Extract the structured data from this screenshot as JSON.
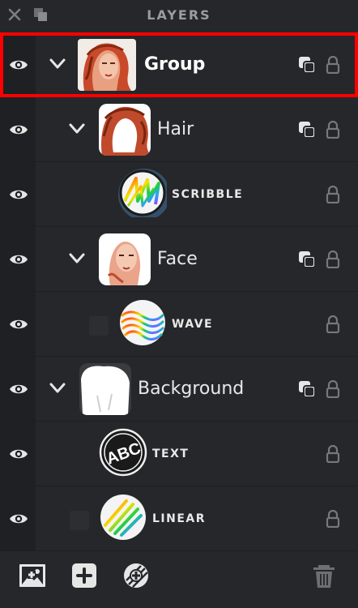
{
  "header": {
    "title": "LAYERS",
    "close_icon": "close-icon",
    "collapse_icon": "collapse-panel-icon"
  },
  "layers": [
    {
      "name": "Group",
      "style": "bold",
      "depth": 0,
      "expanded": true,
      "selected": true,
      "has_mask_button": true,
      "thumb": "portrait"
    },
    {
      "name": "Hair",
      "style": "big",
      "depth": 1,
      "expanded": true,
      "selected": false,
      "has_mask_button": true,
      "thumb": "hair"
    },
    {
      "name": "SCRIBBLE",
      "style": "small",
      "depth": 2,
      "expanded": false,
      "selected": false,
      "has_mask_button": false,
      "thumb": "scribble"
    },
    {
      "name": "Face",
      "style": "big",
      "depth": 1,
      "expanded": true,
      "selected": false,
      "has_mask_button": true,
      "thumb": "face"
    },
    {
      "name": "WAVE",
      "style": "small",
      "depth": 2,
      "expanded": false,
      "selected": false,
      "has_mask_button": false,
      "thumb": "wave"
    },
    {
      "name": "Background",
      "style": "big",
      "depth": 0,
      "expanded": true,
      "selected": false,
      "has_mask_button": true,
      "thumb": "background"
    },
    {
      "name": "TEXT",
      "style": "small",
      "depth": 1,
      "expanded": false,
      "selected": false,
      "has_mask_button": false,
      "thumb": "text"
    },
    {
      "name": "LINEAR",
      "style": "small",
      "depth": 1,
      "expanded": false,
      "selected": false,
      "has_mask_button": false,
      "thumb": "linear"
    }
  ],
  "thumb_text": "ABC",
  "footer": {
    "add_image_icon": "add-image-layer-icon",
    "add_layer_icon": "add-layer-icon",
    "add_effect_icon": "add-effect-icon",
    "delete_icon": "trash-icon"
  },
  "colors": {
    "background": "#26272b",
    "eye_column": "#1f2023",
    "selection": "#ff0000",
    "text": "#e8e8e8"
  }
}
